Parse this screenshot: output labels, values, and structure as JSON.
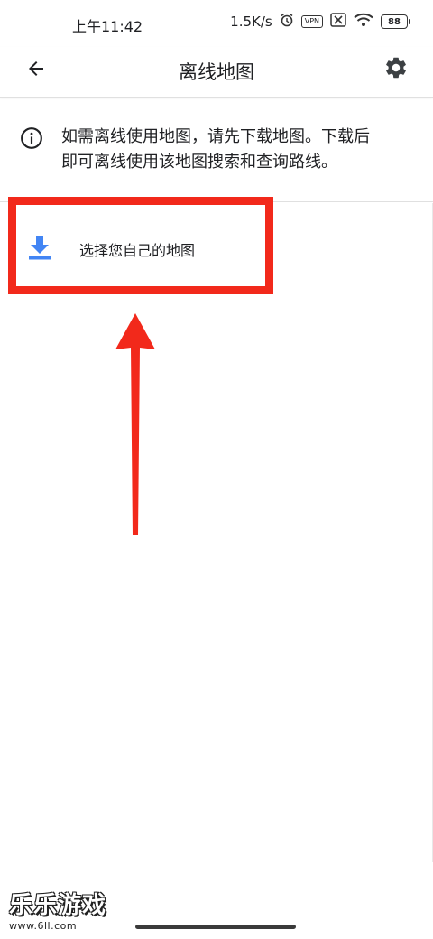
{
  "status_bar": {
    "time": "上午11:42",
    "net_speed": "1.5K/s",
    "vpn_label": "VPN",
    "battery": "88"
  },
  "app_bar": {
    "title": "离线地图",
    "back_icon": "arrow-back-icon",
    "settings_icon": "gear-icon"
  },
  "info": {
    "icon": "info-icon",
    "line1": "如需离线使用地图，请先下载地图。下载后",
    "line2": "即可离线使用该地图搜索和查询路线。"
  },
  "choose_map": {
    "icon": "download-icon",
    "label": "选择您自己的地图"
  },
  "watermark": {
    "name": "乐乐游戏",
    "url": "www.6ll.com"
  },
  "colors": {
    "accent_blue": "#4285f4",
    "annotation_red": "#f2291b",
    "text": "#202124",
    "divider": "#e0e0e0"
  }
}
